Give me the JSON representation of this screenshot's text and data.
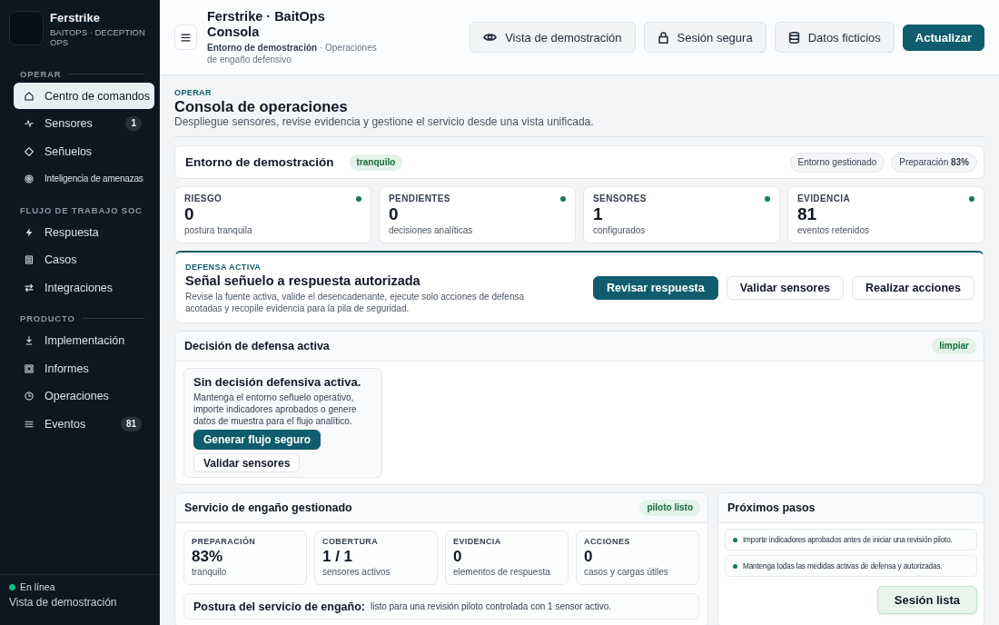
{
  "sidebar": {
    "brand": {
      "name": "Ferstrike",
      "tagline": "BAITOPS · DECEPTION OPS"
    },
    "sections": [
      {
        "heading": "OPERAR",
        "items": [
          {
            "label": "Centro de comandos",
            "selected": true
          },
          {
            "label": "Sensores",
            "selected": false,
            "badge": "1"
          },
          {
            "label": "Señuelos",
            "selected": false
          },
          {
            "label": "Inteligencia de amenazas",
            "selected": false
          }
        ]
      },
      {
        "heading": "FLUJO DE TRABAJO SOC",
        "items": [
          {
            "label": "Respuesta",
            "selected": false
          },
          {
            "label": "Casos",
            "selected": false
          },
          {
            "label": "Integraciones",
            "selected": false
          }
        ]
      },
      {
        "heading": "PRODUCTO",
        "items": [
          {
            "label": "Implementación",
            "selected": false
          },
          {
            "label": "Informes",
            "selected": false
          },
          {
            "label": "Operaciones",
            "selected": false
          },
          {
            "label": "Eventos",
            "selected": false,
            "badge": "81"
          }
        ]
      }
    ],
    "status": {
      "label": "En línea",
      "online": true
    },
    "footer": "Vista de demostración"
  },
  "header": {
    "title": "Ferstrike · BaitOps Consola",
    "breadcrumb": "**Entorno de demostración** · Operaciones de engaño defensivo",
    "buttons": [
      {
        "label": "Vista de demostración",
        "kind": "secondary"
      },
      {
        "label": "Sesión segura",
        "kind": "secondary"
      },
      {
        "label": "Datos ficticios",
        "kind": "secondary"
      },
      {
        "label": "Actualizar",
        "kind": "primary"
      }
    ]
  },
  "page": {
    "eyebrow": "OPERAR",
    "title": "Consola de operaciones",
    "subtitle": "Despliegue sensores, revise evidencia y gestione el servicio desde una vista unificada."
  },
  "environment": {
    "title": "Entorno de demostración",
    "badge": "tranquilo",
    "pills": [
      "Entorno gestionado",
      "Preparación **83%**"
    ]
  },
  "stats": [
    {
      "label": "RIESGO",
      "value": "0",
      "caption": "postura tranquila"
    },
    {
      "label": "PENDIENTES",
      "value": "0",
      "caption": "decisiones analíticas"
    },
    {
      "label": "SENSORES",
      "value": "1",
      "caption": "configurados"
    },
    {
      "label": "EVIDENCIA",
      "value": "81",
      "caption": "eventos retenidos"
    }
  ],
  "active_defense": {
    "eyebrow": "DEFENSA ACTIVA",
    "title": "Señal señuelo a respuesta autorizada",
    "description": "Revise la fuente activa, valide el desencadenante, ejecute solo acciones de defensa acotadas y recopile evidencia para la pila de seguridad.",
    "buttons": [
      {
        "label": "Revisar respuesta",
        "kind": "primary"
      },
      {
        "label": "Validar sensores",
        "kind": "secondary"
      },
      {
        "label": "Realizar acciones",
        "kind": "secondary"
      }
    ]
  },
  "decision": {
    "title": "Decisión de defensa activa",
    "badge": "limpiar",
    "empty_state": {
      "title": "Sin decisión defensiva activa.",
      "description": "Mantenga el entorno señuelo operativo, importe indicadores aprobados o genere datos de muestra para el flujo analítico.",
      "buttons": [
        {
          "label": "Generar flujo seguro",
          "kind": "primary"
        },
        {
          "label": "Validar sensores",
          "kind": "secondary"
        }
      ]
    }
  },
  "service": {
    "title": "Servicio de engaño gestionado",
    "badge": "piloto listo",
    "metrics": [
      {
        "label": "PREPARACIÓN",
        "value": "83%",
        "caption": "tranquilo"
      },
      {
        "label": "COBERTURA",
        "value": "1 / 1",
        "caption": "sensores activos"
      },
      {
        "label": "EVIDENCIA",
        "value": "0",
        "caption": "elementos de respuesta"
      },
      {
        "label": "ACCIONES",
        "value": "0",
        "caption": "casos y cargas útiles"
      }
    ],
    "posture": {
      "label": "Postura del servicio de engaño:",
      "text": "listo para una revisión piloto controlada con 1 sensor activo."
    }
  },
  "next_steps": {
    "title": "Próximos pasos",
    "items": [
      "Importe indicadores aprobados antes de iniciar una revisión piloto.",
      "Mantenga todas las medidas activas de defensa y autorizadas."
    ],
    "button": "Sesión lista"
  }
}
